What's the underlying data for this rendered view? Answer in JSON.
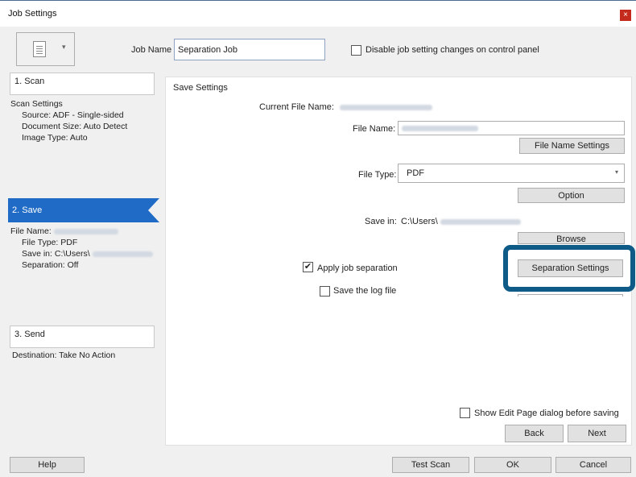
{
  "window": {
    "title": "Job Settings",
    "close_label": "×"
  },
  "header": {
    "job_name_label": "Job Name",
    "job_name_value": "Separation Job",
    "disable_label": "Disable job setting changes on control panel"
  },
  "steps": {
    "scan": {
      "title": "1. Scan",
      "heading": "Scan Settings",
      "source": "Source: ADF - Single-sided",
      "document_size": "Document Size: Auto Detect",
      "image_type": "Image Type: Auto"
    },
    "save": {
      "title": "2. Save",
      "file_name_label": "File Name:",
      "file_type": "File Type: PDF",
      "save_in": "Save in: C:\\Users\\",
      "separation": "Separation: Off"
    },
    "send": {
      "title": "3. Send",
      "destination": "Destination: Take No Action"
    }
  },
  "save_settings": {
    "heading": "Save Settings",
    "current_file_name_label": "Current File Name:",
    "file_name_label": "File Name:",
    "file_name_settings_button": "File Name Settings",
    "file_type_label": "File Type:",
    "file_type_value": "PDF",
    "option_button": "Option",
    "save_in_label": "Save in:",
    "save_in_value": "C:\\Users\\",
    "browse_button": "Browse",
    "apply_job_separation_label": "Apply job separation",
    "apply_job_separation_checked": true,
    "save_log_label": "Save the log file",
    "separation_settings_button": "Separation Settings",
    "show_edit_page_label": "Show Edit Page dialog before saving",
    "back_button": "Back",
    "next_button": "Next"
  },
  "footer": {
    "help_button": "Help",
    "test_scan_button": "Test Scan",
    "ok_button": "OK",
    "cancel_button": "Cancel"
  },
  "icons": {
    "job_icon": "document-icon",
    "dropdown": "chevron-down-icon",
    "checkmark": "✔"
  },
  "colors": {
    "active_step": "#1f6bc5",
    "highlight_border": "#0e5b87",
    "close_button": "#c42b1c"
  }
}
